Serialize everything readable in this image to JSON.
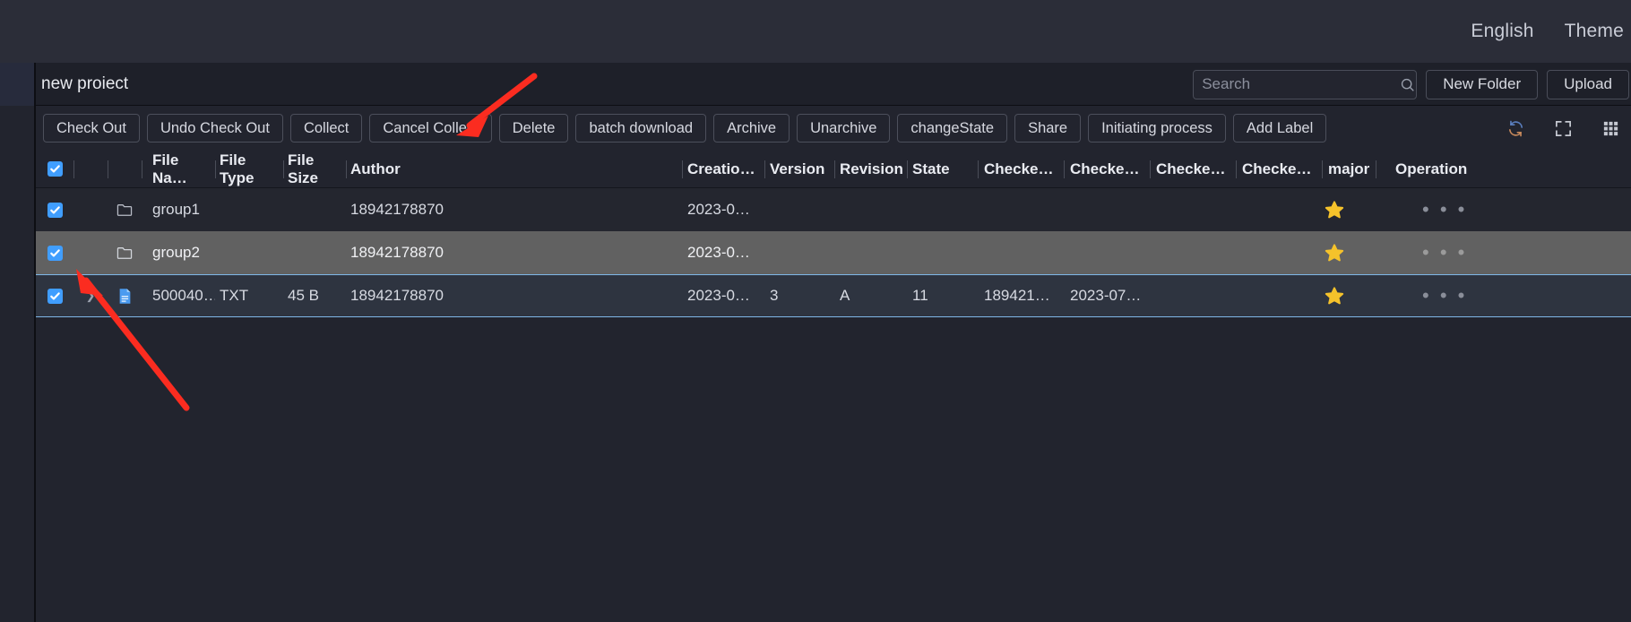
{
  "topbar": {
    "links": [
      {
        "label": "English",
        "name": "language-switcher"
      },
      {
        "label": "Theme",
        "name": "theme-switcher"
      }
    ]
  },
  "header": {
    "project_title": "new proiect",
    "search": {
      "placeholder": "Search",
      "value": "",
      "icon": "search-icon"
    },
    "buttons": [
      {
        "label": "New Folder",
        "name": "new-folder-button"
      },
      {
        "label": "Upload",
        "name": "upload-button"
      }
    ]
  },
  "toolbar": {
    "buttons": [
      {
        "label": "Check Out",
        "name": "check-out-button"
      },
      {
        "label": "Undo Check Out",
        "name": "undo-check-out-button"
      },
      {
        "label": "Collect",
        "name": "collect-button"
      },
      {
        "label": "Cancel Collect",
        "name": "cancel-collect-button"
      },
      {
        "label": "Delete",
        "name": "delete-button"
      },
      {
        "label": "batch download",
        "name": "batch-download-button"
      },
      {
        "label": "Archive",
        "name": "archive-button"
      },
      {
        "label": "Unarchive",
        "name": "unarchive-button"
      },
      {
        "label": "changeState",
        "name": "change-state-button"
      },
      {
        "label": "Share",
        "name": "share-button"
      },
      {
        "label": "Initiating process",
        "name": "initiating-process-button"
      },
      {
        "label": "Add Label",
        "name": "add-label-button"
      }
    ],
    "icons": [
      {
        "name": "refresh-icon"
      },
      {
        "name": "fullscreen-icon"
      },
      {
        "name": "column-settings-icon"
      }
    ]
  },
  "table": {
    "select_all_checked": true,
    "columns": [
      {
        "key": "file_name",
        "label": "File Na…"
      },
      {
        "key": "file_type",
        "label": "File Type"
      },
      {
        "key": "file_size",
        "label": "File Size"
      },
      {
        "key": "author",
        "label": "Author"
      },
      {
        "key": "creation_time",
        "label": "Creatio…"
      },
      {
        "key": "version",
        "label": "Version"
      },
      {
        "key": "revision",
        "label": "Revision"
      },
      {
        "key": "state",
        "label": "State"
      },
      {
        "key": "checked1",
        "label": "Checke…"
      },
      {
        "key": "checked2",
        "label": "Checke…"
      },
      {
        "key": "checked3",
        "label": "Checke…"
      },
      {
        "key": "checked4",
        "label": "Checke…"
      },
      {
        "key": "major",
        "label": "major"
      },
      {
        "key": "operation",
        "label": "Operation"
      }
    ],
    "rows": [
      {
        "checked": true,
        "icon": "folder-icon",
        "expandable": false,
        "file_name": "group1",
        "file_type": "",
        "file_size": "",
        "author": "18942178870",
        "creation_time": "2023-0…",
        "version": "",
        "revision": "",
        "state": "",
        "checked1": "",
        "checked2": "",
        "checked3": "",
        "checked4": "",
        "major": "star-filled",
        "operation": "• • •",
        "highlight": "normal"
      },
      {
        "checked": true,
        "icon": "folder-icon",
        "expandable": false,
        "file_name": "group2",
        "file_type": "",
        "file_size": "",
        "author": "18942178870",
        "creation_time": "2023-0…",
        "version": "",
        "revision": "",
        "state": "",
        "checked1": "",
        "checked2": "",
        "checked3": "",
        "checked4": "",
        "major": "star-filled",
        "operation": "• • •",
        "highlight": "hover"
      },
      {
        "checked": true,
        "icon": "file-txt-icon",
        "expandable": true,
        "file_name": "500040…",
        "file_type": "TXT",
        "file_size": "45 B",
        "author": "18942178870",
        "creation_time": "2023-0…",
        "version": "3",
        "revision": "A",
        "state": "11",
        "checked1": "189421…",
        "checked2": "2023-07…",
        "checked3": "",
        "checked4": "",
        "major": "star-filled",
        "operation": "• • •",
        "highlight": "selected"
      }
    ]
  },
  "annotations": {
    "arrows": [
      {
        "name": "arrow-to-cancel-collect",
        "color": "#fb2c20"
      },
      {
        "name": "arrow-to-row-checkbox",
        "color": "#fb2c20"
      }
    ]
  },
  "colors": {
    "accent": "#409eff",
    "star": "#f5c22b",
    "background": "#22242e",
    "topbar": "#2b2d38",
    "row_hover": "#616161",
    "row_selected": "#2e3440",
    "annotation_red": "#fb2c20"
  }
}
